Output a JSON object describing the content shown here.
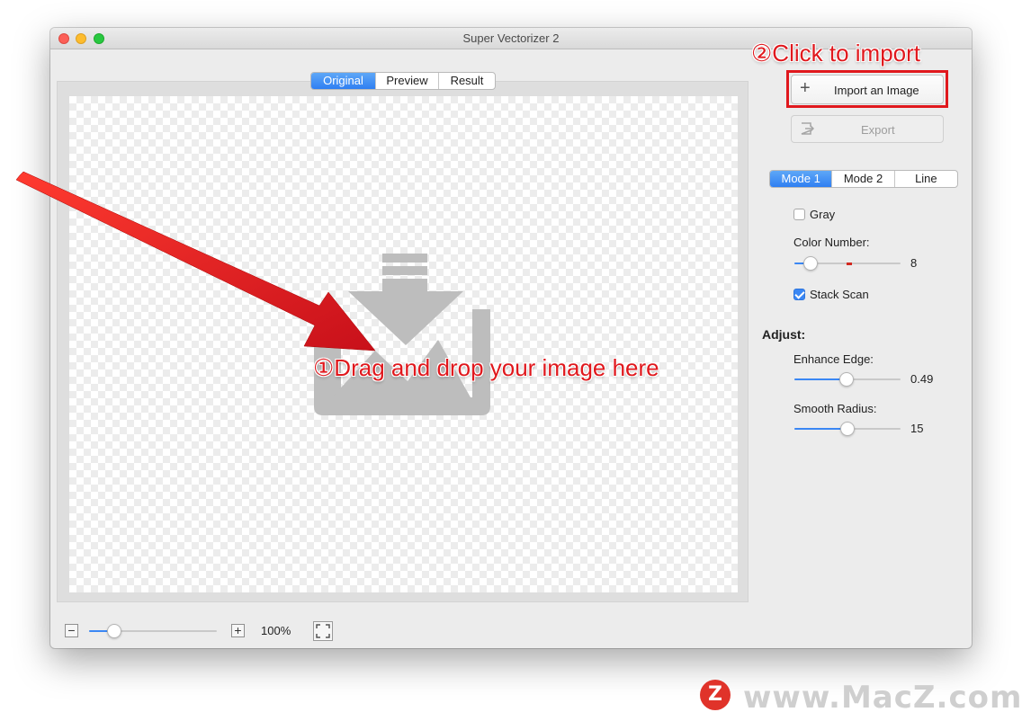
{
  "window": {
    "title": "Super Vectorizer 2"
  },
  "view_tabs": [
    {
      "label": "Original",
      "active": true
    },
    {
      "label": "Preview",
      "active": false
    },
    {
      "label": "Result",
      "active": false
    }
  ],
  "sidebar": {
    "import_label": "Import an Image",
    "export_label": "Export",
    "mode_tabs": [
      {
        "label": "Mode 1",
        "active": true
      },
      {
        "label": "Mode 2",
        "active": false
      },
      {
        "label": "Line",
        "active": false
      }
    ],
    "gray": {
      "label": "Gray",
      "checked": false
    },
    "color_number": {
      "label": "Color Number:",
      "value": "8",
      "fraction": 0.15
    },
    "stack_scan": {
      "label": "Stack Scan",
      "checked": true
    },
    "adjust_label": "Adjust:",
    "enhance_edge": {
      "label": "Enhance Edge:",
      "value": "0.49",
      "fraction": 0.49
    },
    "smooth_radius": {
      "label": "Smooth Radius:",
      "value": "15",
      "fraction": 0.5
    }
  },
  "zoom": {
    "value": "100%",
    "fraction": 0.2
  },
  "annotations": {
    "drag_text": "①Drag and drop your image here",
    "import_text": "②Click to import",
    "color": "#e0181d"
  },
  "watermark": {
    "logo": "Z",
    "text": "www.MacZ.com"
  },
  "colors": {
    "accent": "#3a87f4",
    "window_bg": "#ececec"
  }
}
